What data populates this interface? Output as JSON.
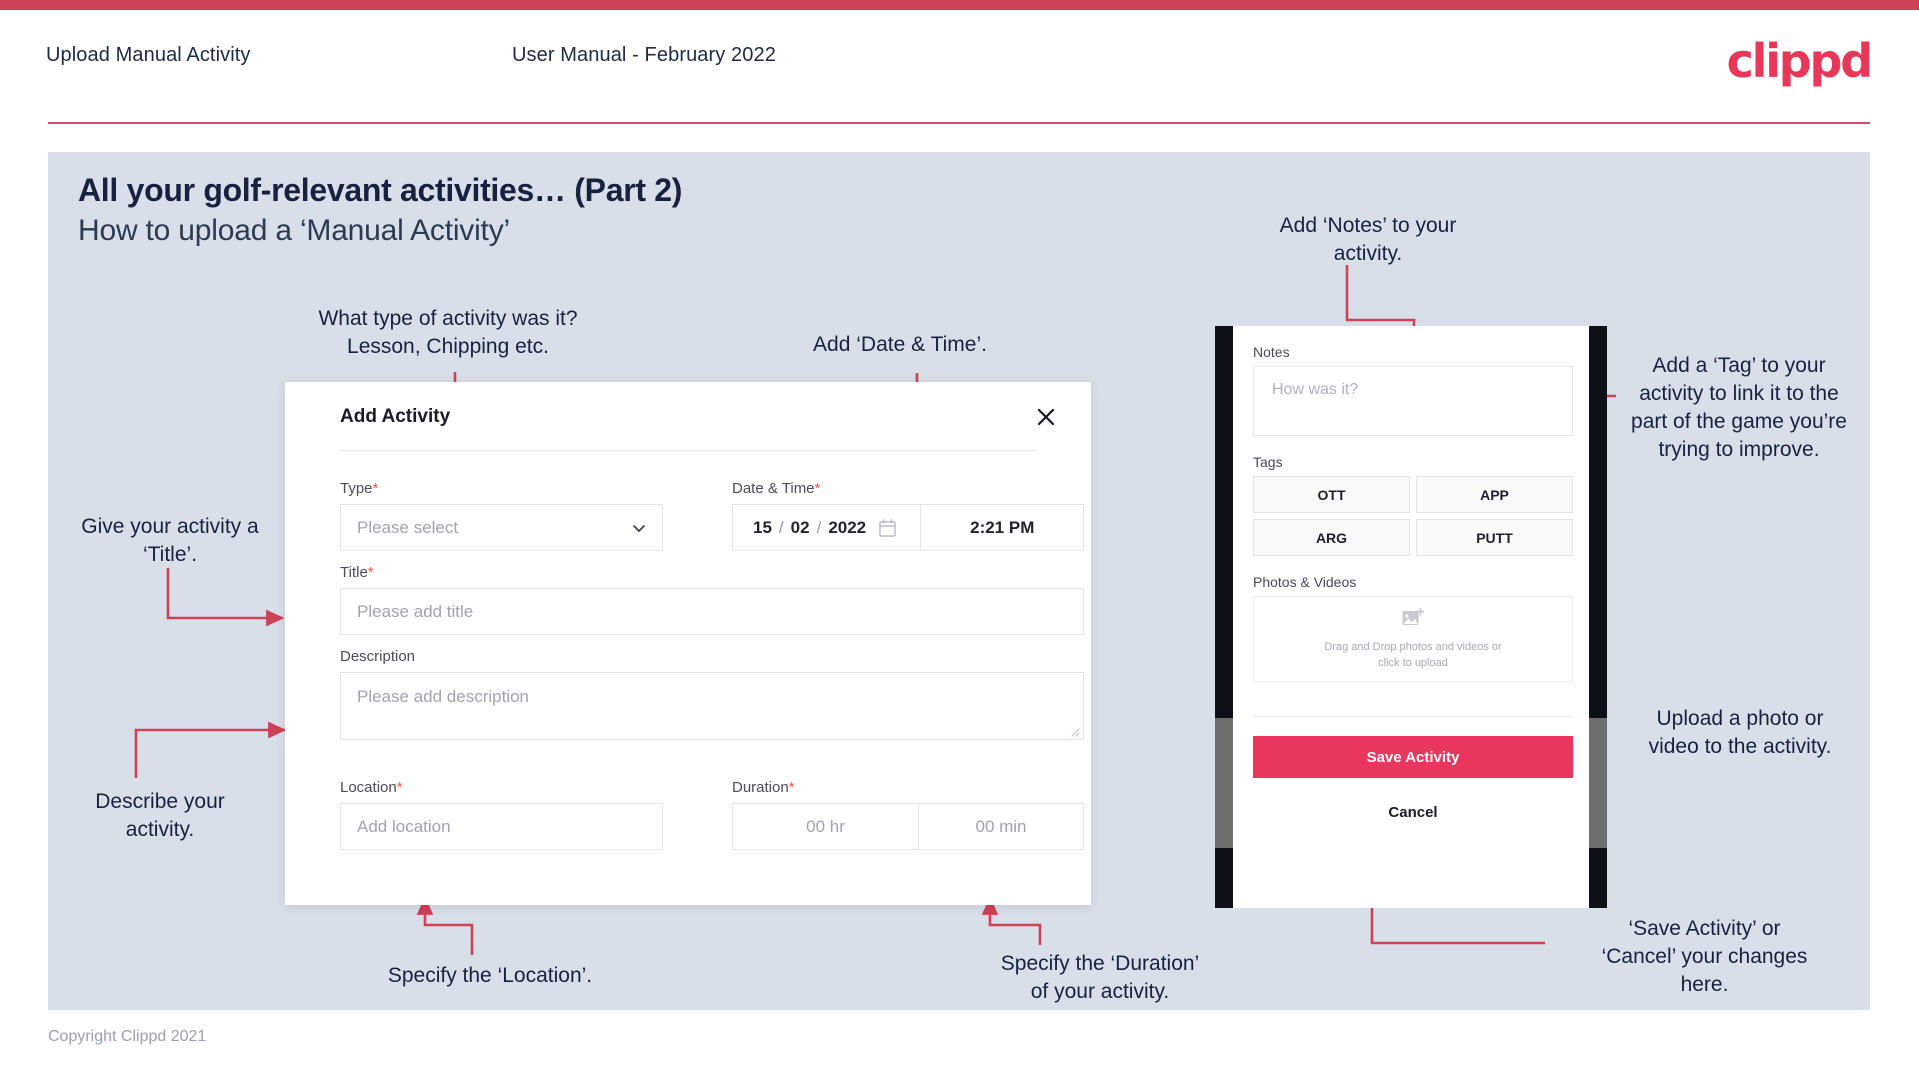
{
  "header": {
    "title": "Upload Manual Activity",
    "subtitle": "User Manual - February 2022",
    "logo": "clippd"
  },
  "slide": {
    "title": "All your golf-relevant activities… (Part 2)",
    "subtitle": "How to upload a ‘Manual Activity’"
  },
  "annotations": {
    "type": "What type of activity was it?\nLesson, Chipping etc.",
    "type_line1": "What type of activity was it?",
    "type_line2": "Lesson, Chipping etc.",
    "datetime": "Add ‘Date & Time’.",
    "title_l1": "Give your activity a",
    "title_l2": "‘Title’.",
    "describe_l1": "Describe your",
    "describe_l2": "activity.",
    "location": "Specify the ‘Location’.",
    "duration_l1": "Specify the ‘Duration’",
    "duration_l2": "of your activity.",
    "notes_l1": "Add ‘Notes’ to your",
    "notes_l2": "activity.",
    "tag": "Add a ‘Tag’ to your activity to link it to the part of the game you’re trying to improve.",
    "upload_l1": "Upload a photo or",
    "upload_l2": "video to the activity.",
    "save_l1": "‘Save Activity’ or",
    "save_l2": "‘Cancel’ your changes",
    "save_l3": "here."
  },
  "dialog": {
    "title": "Add Activity",
    "close_icon": "close-icon",
    "fields": {
      "type_label": "Type",
      "type_placeholder": "Please select",
      "datetime_label": "Date & Time",
      "date_day": "15",
      "date_month": "02",
      "date_year": "2022",
      "date_sep": "/",
      "time_value": "2:21 PM",
      "title_label": "Title",
      "title_placeholder": "Please add title",
      "description_label": "Description",
      "description_placeholder": "Please add description",
      "location_label": "Location",
      "location_placeholder": "Add location",
      "duration_label": "Duration",
      "duration_hr": "00 hr",
      "duration_min": "00 min",
      "required_mark": "*"
    }
  },
  "mobile": {
    "notes_label": "Notes",
    "notes_placeholder": "How was it?",
    "tags_label": "Tags",
    "tags": [
      "OTT",
      "APP",
      "ARG",
      "PUTT"
    ],
    "photos_label": "Photos & Videos",
    "dropzone_l1": "Drag and Drop photos and videos or",
    "dropzone_l2": "click to upload",
    "save_label": "Save Activity",
    "cancel_label": "Cancel"
  },
  "footer": "Copyright Clippd 2021",
  "colors": {
    "accent": "#e8385a",
    "bar": "#cc4257",
    "slide_bg": "#d9dfe8",
    "text_dark": "#182240",
    "arrow": "#cc4257"
  }
}
